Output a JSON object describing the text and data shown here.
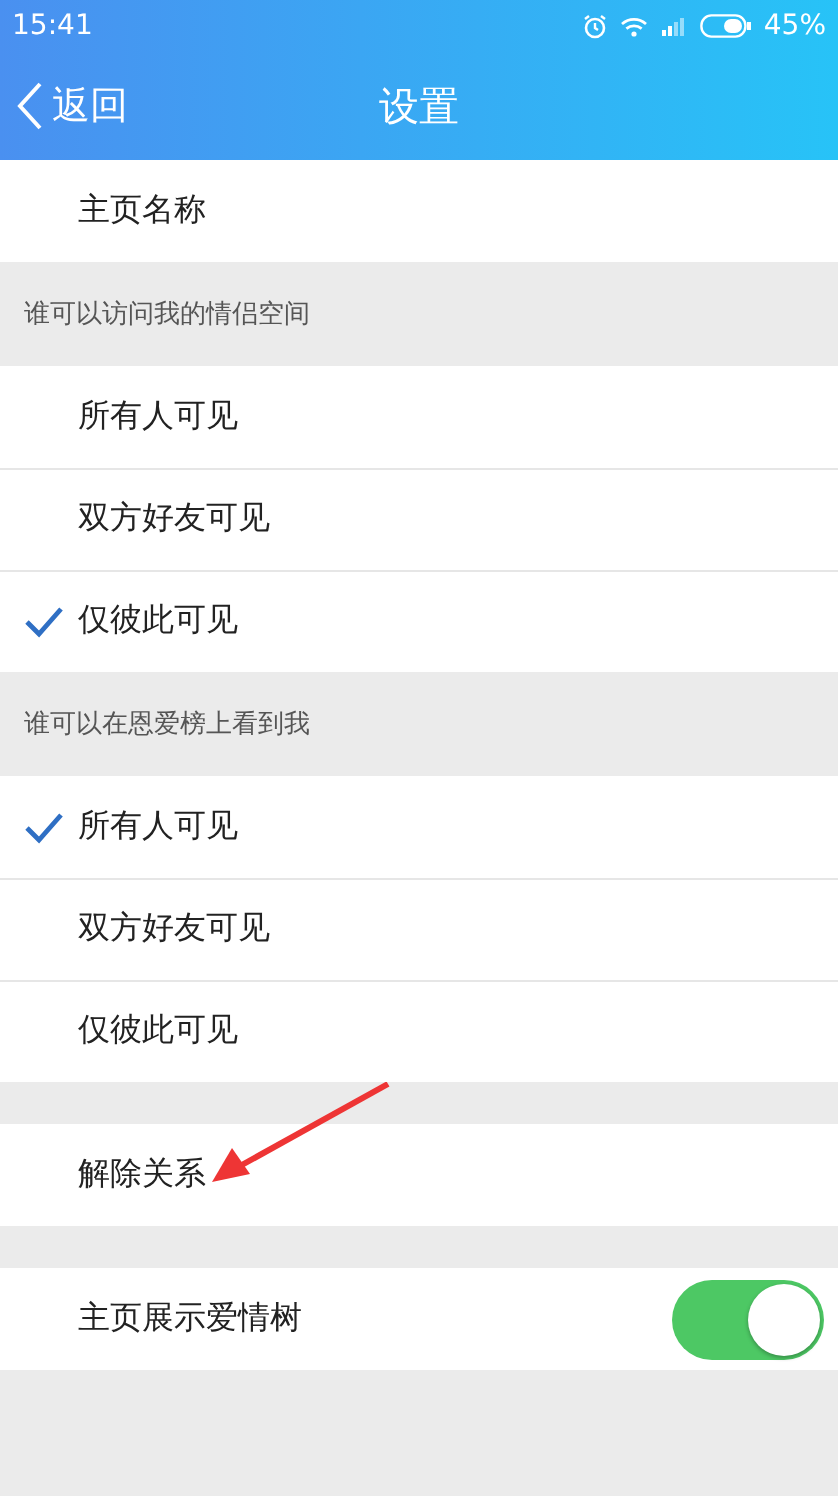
{
  "status_bar": {
    "time": "15:41",
    "battery": "45%"
  },
  "nav": {
    "back": "返回",
    "title": "设置"
  },
  "groups": [
    {
      "rows": [
        {
          "kind": "plain",
          "label": "主页名称"
        }
      ]
    },
    {
      "header": "谁可以访问我的情侣空间",
      "rows": [
        {
          "kind": "radio",
          "label": "所有人可见",
          "selected": false
        },
        {
          "kind": "radio",
          "label": "双方好友可见",
          "selected": false
        },
        {
          "kind": "radio",
          "label": "仅彼此可见",
          "selected": true
        }
      ]
    },
    {
      "header": "谁可以在恩爱榜上看到我",
      "rows": [
        {
          "kind": "radio",
          "label": "所有人可见",
          "selected": true
        },
        {
          "kind": "radio",
          "label": "双方好友可见",
          "selected": false
        },
        {
          "kind": "radio",
          "label": "仅彼此可见",
          "selected": false
        }
      ]
    },
    {
      "rows": [
        {
          "kind": "plain",
          "label": "解除关系"
        }
      ]
    },
    {
      "rows": [
        {
          "kind": "toggle",
          "label": "主页展示爱情树",
          "on": true
        }
      ]
    }
  ]
}
